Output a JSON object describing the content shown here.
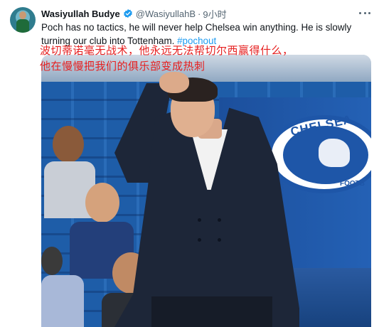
{
  "tweet": {
    "author_name": "Wasiyullah Budye",
    "handle": "@WasiyullahB",
    "separator": "·",
    "time": "9小时",
    "text": "Poch has no tactics, he will never help Chelsea win anything. He is slowly turning our club into Tottenham.",
    "hashtag": "#pochout"
  },
  "overlay": {
    "line1": "波切蒂诺毫无战术，他永远无法帮切尔西赢得什么，",
    "line2": "他在慢慢把我们的俱乐部变成热刺"
  },
  "media": {
    "badge_text_top": "CHELSEA",
    "badge_text_bottom": "FOOTB"
  },
  "colors": {
    "hashtag": "#1d9bf0",
    "verified": "#1d9bf0",
    "overlay_text": "#e62020"
  },
  "icons": {
    "verified": "verified-badge-icon",
    "more": "more-dots-icon"
  }
}
